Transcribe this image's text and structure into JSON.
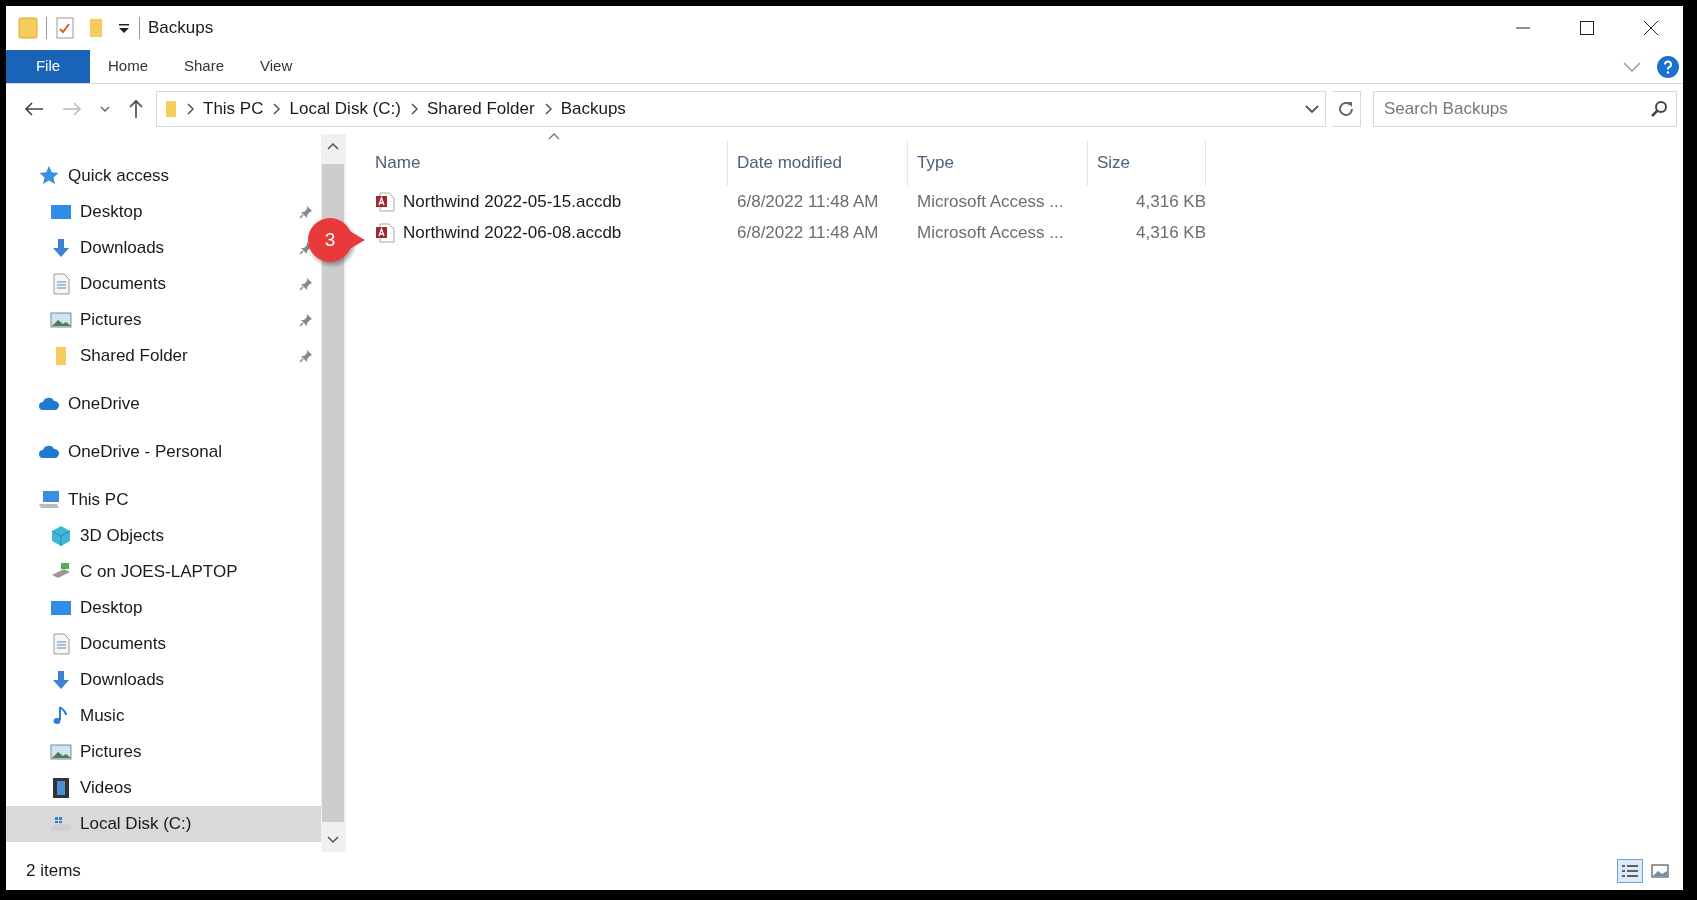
{
  "window": {
    "title": "Backups"
  },
  "ribbon_tabs": [
    {
      "label": "File",
      "kind": "file",
      "selected": false
    },
    {
      "label": "Home",
      "kind": "tab",
      "selected": false
    },
    {
      "label": "Share",
      "kind": "tab",
      "selected": false
    },
    {
      "label": "View",
      "kind": "tab",
      "selected": false
    }
  ],
  "address_bar": {
    "path": [
      "This PC",
      "Local Disk (C:)",
      "Shared Folder",
      "Backups"
    ]
  },
  "search": {
    "placeholder": "Search Backups"
  },
  "navigation": [
    {
      "label": "Quick access",
      "kind": "star",
      "selected": false,
      "children": [
        {
          "label": "Desktop",
          "kind": "desktop",
          "pinned": true,
          "selected": false
        },
        {
          "label": "Downloads",
          "kind": "download",
          "pinned": true,
          "selected": false
        },
        {
          "label": "Documents",
          "kind": "document",
          "pinned": true,
          "selected": false
        },
        {
          "label": "Pictures",
          "kind": "pictures",
          "pinned": true,
          "selected": false
        },
        {
          "label": "Shared Folder",
          "kind": "folder",
          "pinned": true,
          "selected": false
        }
      ]
    },
    {
      "label": "OneDrive",
      "kind": "cloud",
      "selected": false
    },
    {
      "label": "OneDrive - Personal",
      "kind": "cloud",
      "selected": false
    },
    {
      "label": "This PC",
      "kind": "pc",
      "selected": false,
      "children": [
        {
          "label": "3D Objects",
          "kind": "cube",
          "selected": false
        },
        {
          "label": "C on JOES-LAPTOP",
          "kind": "netdrive",
          "selected": false
        },
        {
          "label": "Desktop",
          "kind": "desktop",
          "selected": false
        },
        {
          "label": "Documents",
          "kind": "document",
          "selected": false
        },
        {
          "label": "Downloads",
          "kind": "download",
          "selected": false
        },
        {
          "label": "Music",
          "kind": "music",
          "selected": false
        },
        {
          "label": "Pictures",
          "kind": "pictures",
          "selected": false
        },
        {
          "label": "Videos",
          "kind": "video",
          "selected": false
        },
        {
          "label": "Local Disk (C:)",
          "kind": "disk",
          "selected": true
        }
      ]
    }
  ],
  "columns": [
    {
      "label": "Name",
      "sorted": true
    },
    {
      "label": "Date modified",
      "sorted": false
    },
    {
      "label": "Type",
      "sorted": false
    },
    {
      "label": "Size",
      "sorted": false
    }
  ],
  "files": [
    {
      "name": "Northwind 2022-05-15.accdb",
      "date": "6/8/2022 11:48 AM",
      "type": "Microsoft Access ...",
      "size": "4,316 KB"
    },
    {
      "name": "Northwind 2022-06-08.accdb",
      "date": "6/8/2022 11:48 AM",
      "type": "Microsoft Access ...",
      "size": "4,316 KB"
    }
  ],
  "callout": {
    "text": "3"
  },
  "status_bar": {
    "count": "2 items"
  },
  "view_buttons": [
    {
      "kind": "details",
      "selected": true
    },
    {
      "kind": "large",
      "selected": false
    }
  ]
}
